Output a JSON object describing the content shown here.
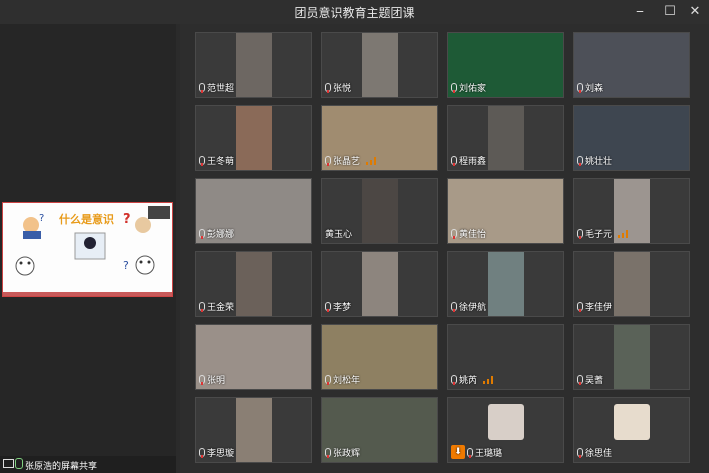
{
  "window": {
    "title": "团员意识教育主题团课",
    "controls": [
      "⎯",
      "☐",
      "✕"
    ]
  },
  "share": {
    "caption": "张原浩的屏幕共享",
    "slide_heading": "什么是意识"
  },
  "participants": [
    {
      "name": "范世超",
      "speaking": false
    },
    {
      "name": "张悦",
      "speaking": false
    },
    {
      "name": "刘佑家",
      "speaking": false
    },
    {
      "name": "刘森",
      "speaking": false
    },
    {
      "name": "王冬萌",
      "speaking": false
    },
    {
      "name": "张晶艺",
      "speaking": true
    },
    {
      "name": "程雨鑫",
      "speaking": false
    },
    {
      "name": "姚壮壮",
      "speaking": false
    },
    {
      "name": "彭娜娜",
      "speaking": false
    },
    {
      "name": "黄玉心",
      "speaking": false
    },
    {
      "name": "黄佳怡",
      "speaking": false
    },
    {
      "name": "毛子元",
      "speaking": true
    },
    {
      "name": "王金荣",
      "speaking": false
    },
    {
      "name": "李梦",
      "speaking": false
    },
    {
      "name": "徐伊航",
      "speaking": false
    },
    {
      "name": "李佳伊",
      "speaking": false
    },
    {
      "name": "张明",
      "speaking": false
    },
    {
      "name": "刘松年",
      "speaking": false
    },
    {
      "name": "姚芮",
      "speaking": true
    },
    {
      "name": "吴蓍",
      "speaking": false
    },
    {
      "name": "李思璇",
      "speaking": false
    },
    {
      "name": "张政辉",
      "speaking": false
    },
    {
      "name": "王璐璐",
      "speaking": false
    },
    {
      "name": "徐思佳",
      "speaking": false
    }
  ],
  "colors": {
    "background": "#2b2b2b",
    "speaking_indicator": "#e07b00",
    "share_border": "#c44444"
  }
}
